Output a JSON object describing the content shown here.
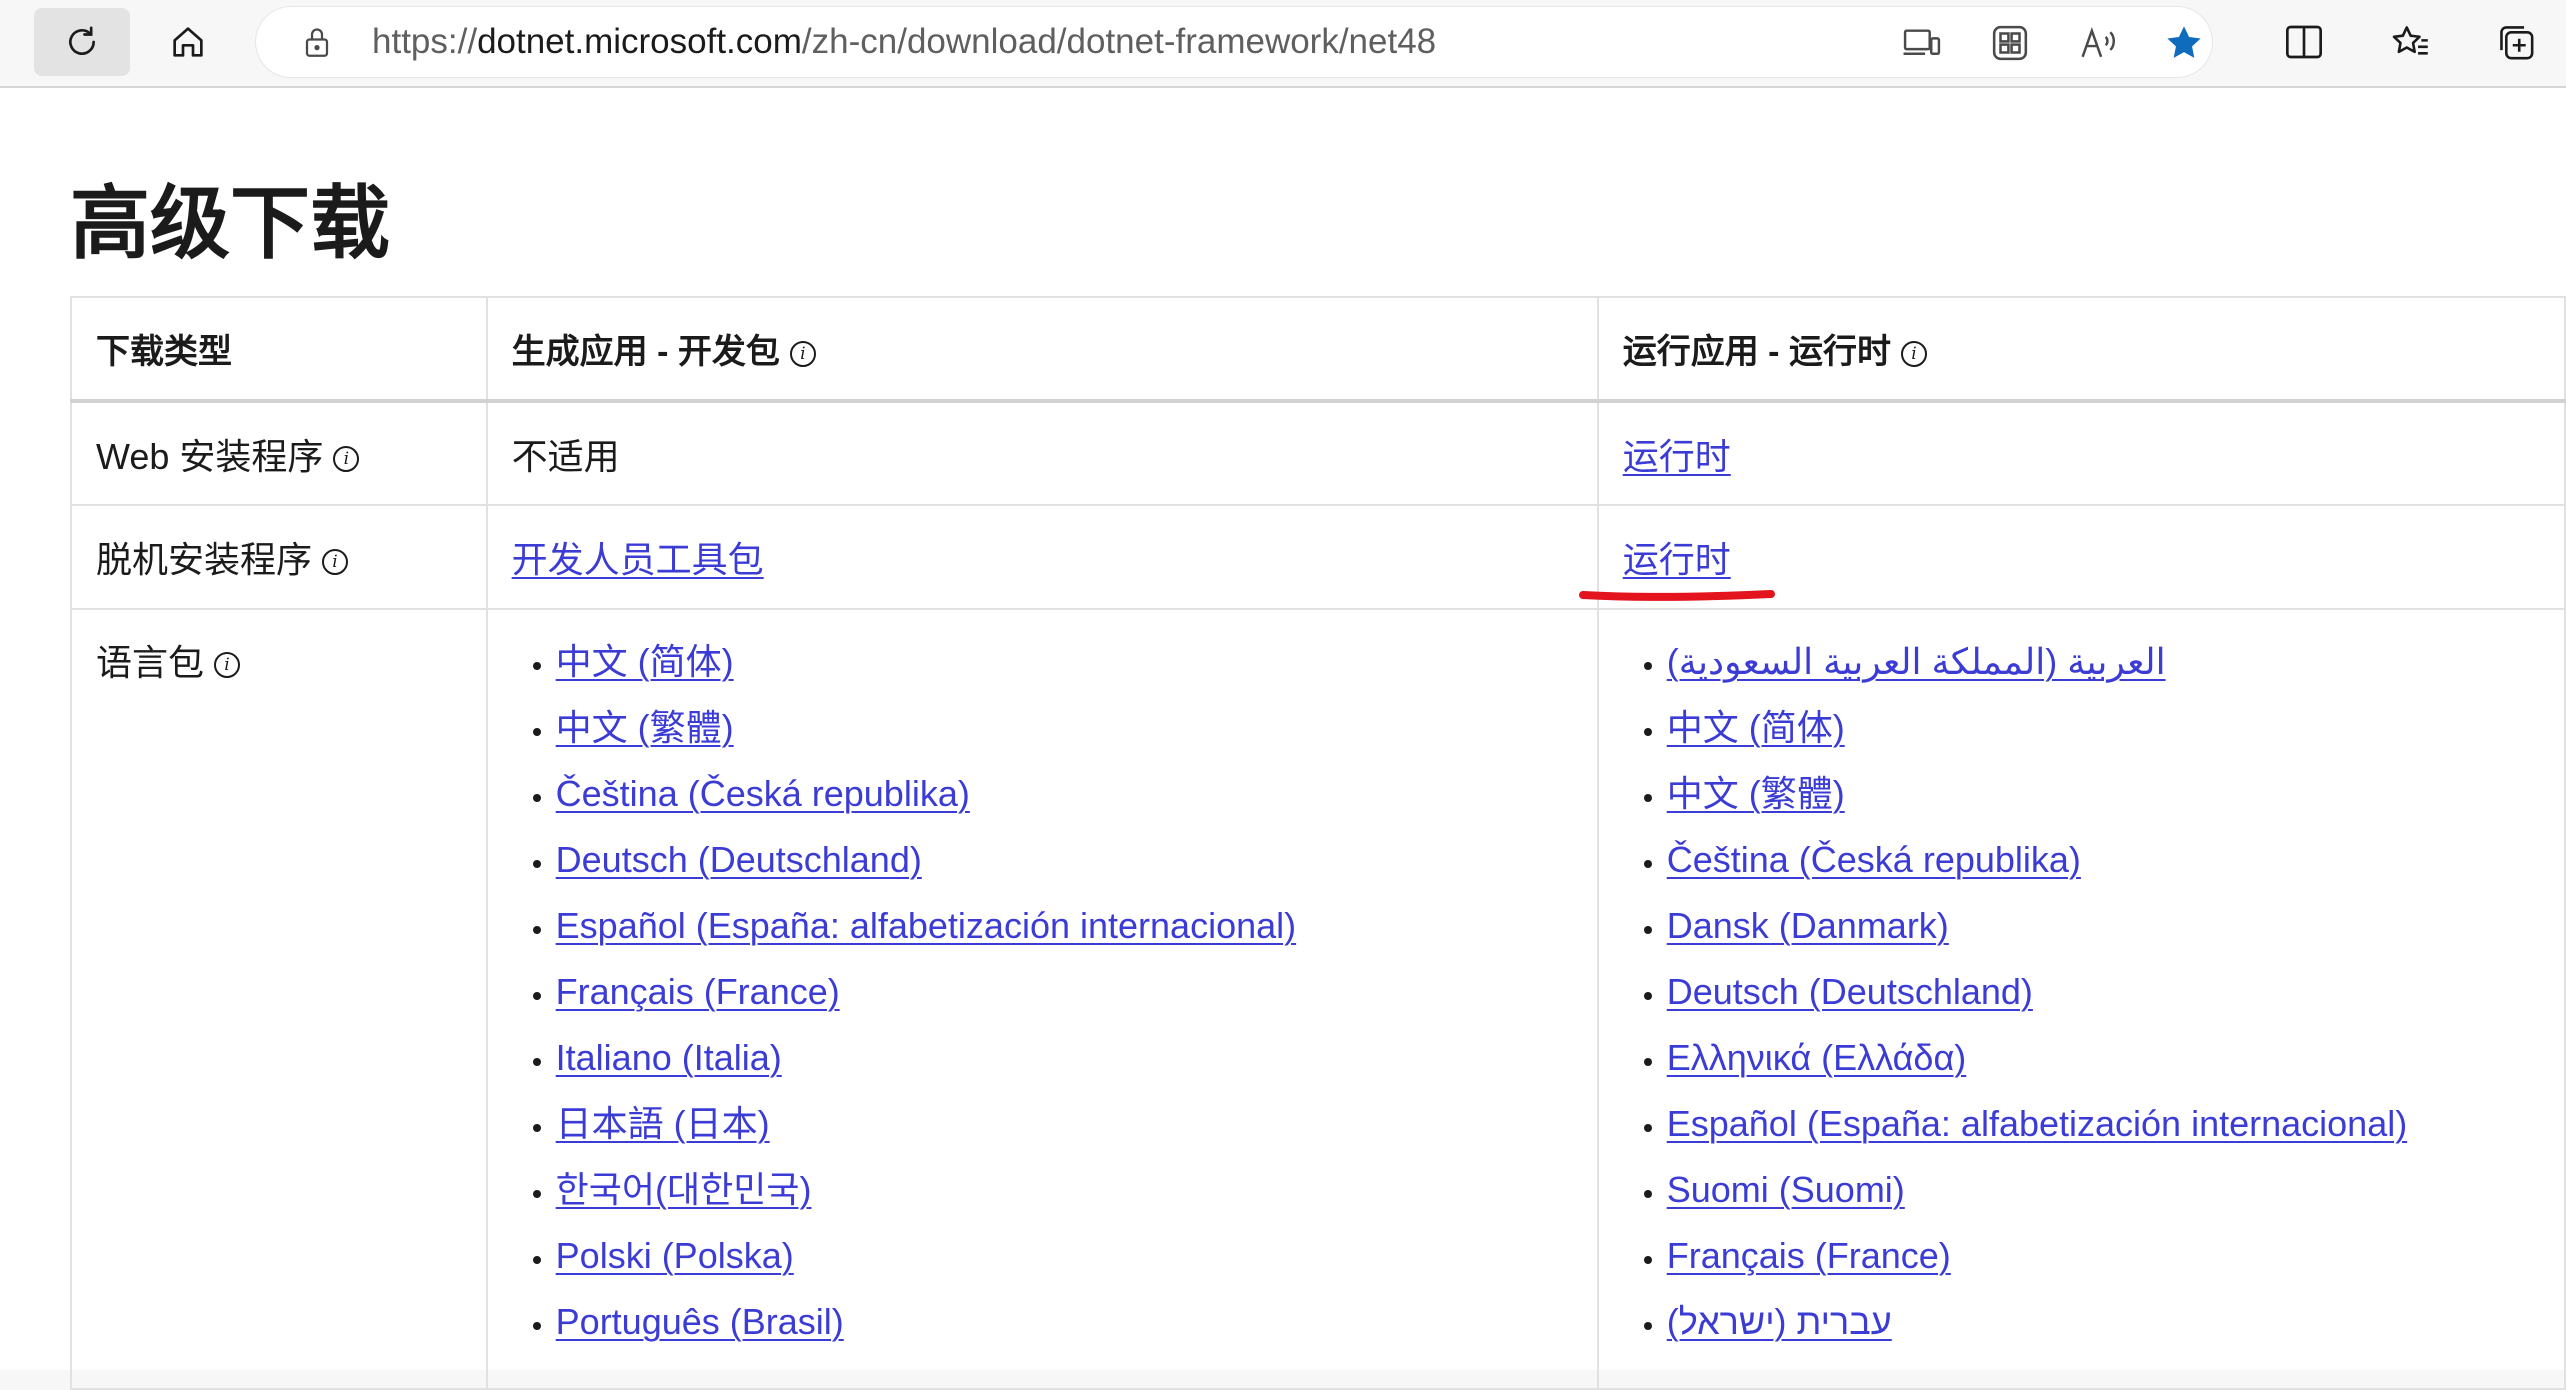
{
  "browser": {
    "url_prefix": "https://",
    "url_host": "dotnet.microsoft.com",
    "url_path": "/zh-cn/download/dotnet-framework/net48",
    "accent_color": "#0f6cbd"
  },
  "page": {
    "title": "高级下载",
    "table": {
      "headers": [
        "下载类型",
        "生成应用 - 开发包",
        "运行应用 - 运行时"
      ],
      "rows": [
        {
          "type": "Web 安装程序",
          "dev": "不适用",
          "runtime": "运行时"
        },
        {
          "type": "脱机安装程序",
          "dev": "开发人员工具包",
          "runtime": "运行时"
        }
      ],
      "lang_row_label": "语言包",
      "dev_langs": [
        "中文 (简体)",
        "中文 (繁體)",
        "Čeština (Česká republika)",
        "Deutsch (Deutschland)",
        "Español (España: alfabetización internacional)",
        "Français (France)",
        "Italiano (Italia)",
        "日本語 (日本)",
        "한국어(대한민국)",
        "Polski (Polska)",
        "Português (Brasil)"
      ],
      "runtime_langs": [
        "العربية (المملكة العربية السعودية)",
        "中文 (简体)",
        "中文 (繁體)",
        "Čeština (Česká republika)",
        "Dansk (Danmark)",
        "Deutsch (Deutschland)",
        "Ελληνικά (Ελλάδα)",
        "Español (España: alfabetización internacional)",
        "Suomi (Suomi)",
        "Français (France)",
        "עברית (ישראל)"
      ]
    }
  }
}
